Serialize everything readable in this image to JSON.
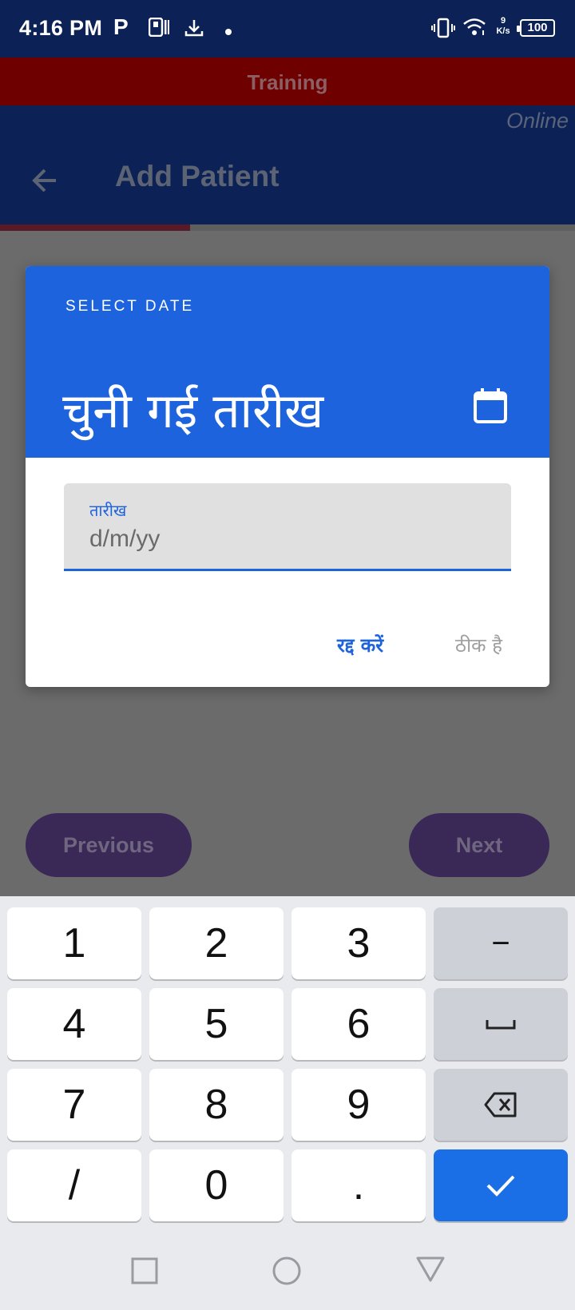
{
  "status_bar": {
    "time": "4:16 PM",
    "net_speed_value": "9",
    "net_speed_unit": "K/s",
    "battery": "100",
    "icons": [
      "parking-icon",
      "paytm-icon",
      "download-icon",
      "notification-dot-icon",
      "vibrate-icon",
      "wifi-icon",
      "battery-icon"
    ]
  },
  "banner": {
    "label": "Training"
  },
  "app_bar": {
    "connection_status": "Online",
    "title": "Add Patient",
    "back_icon": "arrow-left-icon",
    "progress_fraction": 0.33
  },
  "dialog": {
    "subtitle": "SELECT DATE",
    "headline": "चुनी गई तारीख",
    "mode_icon": "calendar-icon",
    "field_label": "तारीख",
    "field_placeholder": "d/m/yy",
    "field_value": "",
    "cancel_label": "रद्द करें",
    "ok_label": "ठीक है"
  },
  "navigation": {
    "previous_label": "Previous",
    "next_label": "Next"
  },
  "keyboard": {
    "rows": [
      [
        "1",
        "2",
        "3",
        "−"
      ],
      [
        "4",
        "5",
        "6",
        "space-icon"
      ],
      [
        "7",
        "8",
        "9",
        "backspace-icon"
      ],
      [
        "/",
        "0",
        ".",
        "checkmark-icon"
      ]
    ]
  },
  "colors": {
    "status_bar": "#0c2257",
    "banner": "#6e0000",
    "accent": "#1e63de",
    "nav_button": "#3a2856",
    "enter_key": "#1a6fe6"
  }
}
